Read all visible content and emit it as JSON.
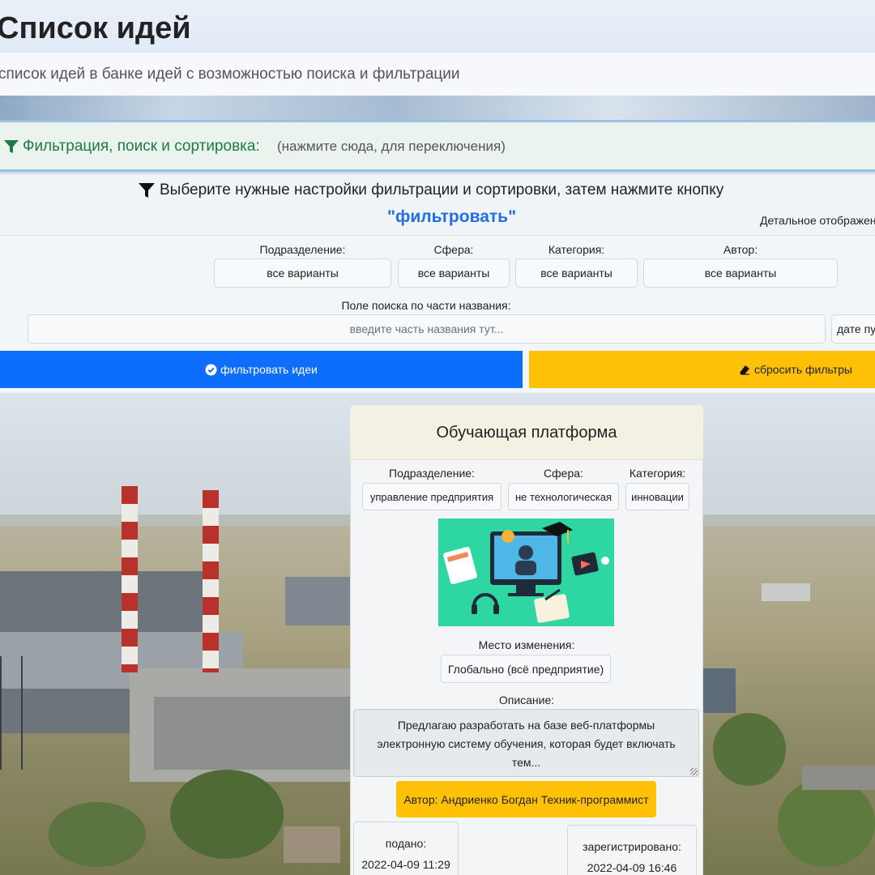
{
  "header": {
    "title": "Список идей",
    "subtitle": "список идей в банке идей с возможностью поиска и фильтрации"
  },
  "filter_toggle": {
    "label": "Фильтрация, поиск и сортировка:",
    "hint": "(нажмите сюда, для переключения)",
    "icon": "filter-icon"
  },
  "filter_panel": {
    "instruction": "Выберите нужные настройки фильтрации и сортировки, затем нажмите кнопку",
    "button_ref": "\"фильтровать\"",
    "detail_toggle": "Детальное отображен",
    "fields": {
      "division": {
        "label": "Подразделение:",
        "value": "все варианты"
      },
      "sphere": {
        "label": "Сфера:",
        "value": "все варианты"
      },
      "category": {
        "label": "Категория:",
        "value": "все варианты"
      },
      "author": {
        "label": "Автор:",
        "value": "все варианты"
      }
    },
    "search": {
      "label": "Поле поиска по части названия:",
      "placeholder": "введите часть названия тут..."
    },
    "sort_value": "дате пу",
    "filter_button": "фильтровать идеи",
    "reset_button": "сбросить фильтры"
  },
  "card": {
    "title": "Обучающая платформа",
    "division_label": "Подразделение:",
    "division_value": "управление предприятия",
    "sphere_label": "Сфера:",
    "sphere_value": "не технологическая",
    "category_label": "Категория:",
    "category_value": "инновации",
    "place_label": "Место изменения:",
    "place_value": "Глобально (всё предприятие)",
    "description_label": "Описание:",
    "description": "Предлагаю разработать на базе веб-платформы электронную систему обучения, которая будет включать тем...",
    "author_button": "Автор: Андриенко Богдан Техник-программист",
    "submitted_label": "подано:",
    "submitted_value": "2022-04-09 11:29",
    "registered_label": "зарегистрировано:",
    "registered_value": "2022-04-09 16:46"
  },
  "colors": {
    "primary": "#0d6efd",
    "warning": "#ffc107",
    "toggle_green": "#1f7a44",
    "illustration_bg": "#2ed6a1"
  }
}
